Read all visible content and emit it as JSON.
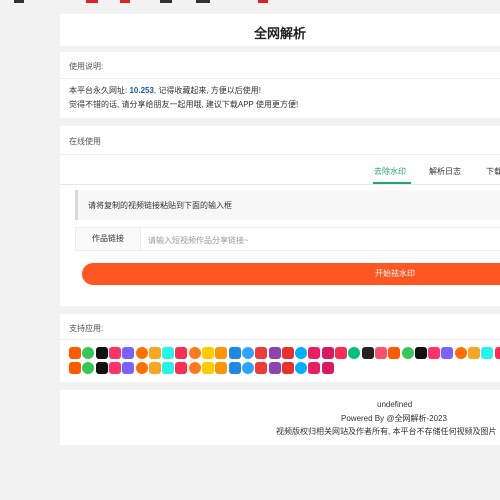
{
  "header": {
    "title": "全网解析"
  },
  "notice": {
    "section_title": "使用说明:",
    "line1_prefix": "本平台永久网址: ",
    "line1_link": "10.253",
    "line1_suffix": ", 记得收藏起来, 方便以后使用!",
    "line2": "觉得不错的话, 请分享给朋友一起用哦, 建议下载APP 使用更方便!"
  },
  "online": {
    "section_title": "在线使用",
    "tabs": [
      {
        "label": "去除水印",
        "active": true
      },
      {
        "label": "解析日志",
        "active": false
      },
      {
        "label": "下载APP",
        "active": false
      }
    ],
    "tip": "请将复制的视频链接粘贴到下面的输入框",
    "input_label": "作品链接",
    "input_placeholder": "请输入短视频作品分享链接~",
    "input_value": "",
    "start_button": "开始祛水印",
    "accent_color": "#22a86a",
    "button_color": "#ff5722"
  },
  "support": {
    "section_title": "支持应用:",
    "app_icons_row1": [
      "douyin-icon",
      "kuaishou-icon",
      "xiaohongshu-icon",
      "weibo-icon",
      "pipixia-icon",
      "bilibili-icon",
      "haokan-icon",
      "zuiyou-icon",
      "weishi-icon",
      "youku-icon",
      "ixigua-icon",
      "tiktok-icon",
      "quanmin-icon",
      "capcut-icon",
      "toutiao-icon",
      "momo-icon",
      "kuaishou-lite-icon",
      "xiaoying-icon",
      "huoshan-icon",
      "lofter-icon",
      "meipai-icon",
      "youtube-icon",
      "lvzhou-icon",
      "douyin-lite-icon",
      "taobao-icon",
      "meitu-icon",
      "kuaikan-icon",
      "pinduoduo-icon",
      "acfun-icon",
      "momo-video-icon",
      "zhihu-icon",
      "qutoutiao-icon",
      "jingdong-icon"
    ],
    "app_icons_row2": [
      "weishi-lite-icon",
      "yinke-icon",
      "douyin-fire-icon",
      "xiaokaxiu-icon",
      "tantan-icon",
      "meishe-icon",
      "twitter-icon",
      "kuaishou-live-icon",
      "pinduoduo-video-icon",
      "huya-icon",
      "qq-icon",
      "taobao-live-icon",
      "pinpin-icon",
      "xiaoxiong-icon",
      "kuaiyin-icon",
      "wechat-icon",
      "douyu-icon",
      "huoshan-lite-icon",
      "quanmin-k-icon",
      "weishi-red-icon"
    ]
  },
  "footer": {
    "line1": "undefined",
    "line2": "Powered By @全网解析-2023",
    "line3": "视频版权归相关网站及作者所有, 本平台不存储任何视频及图片"
  },
  "top_strip_colors": [
    "#333333",
    "#e02020",
    "#e02020",
    "#333333",
    "#333333",
    "#e02020"
  ]
}
